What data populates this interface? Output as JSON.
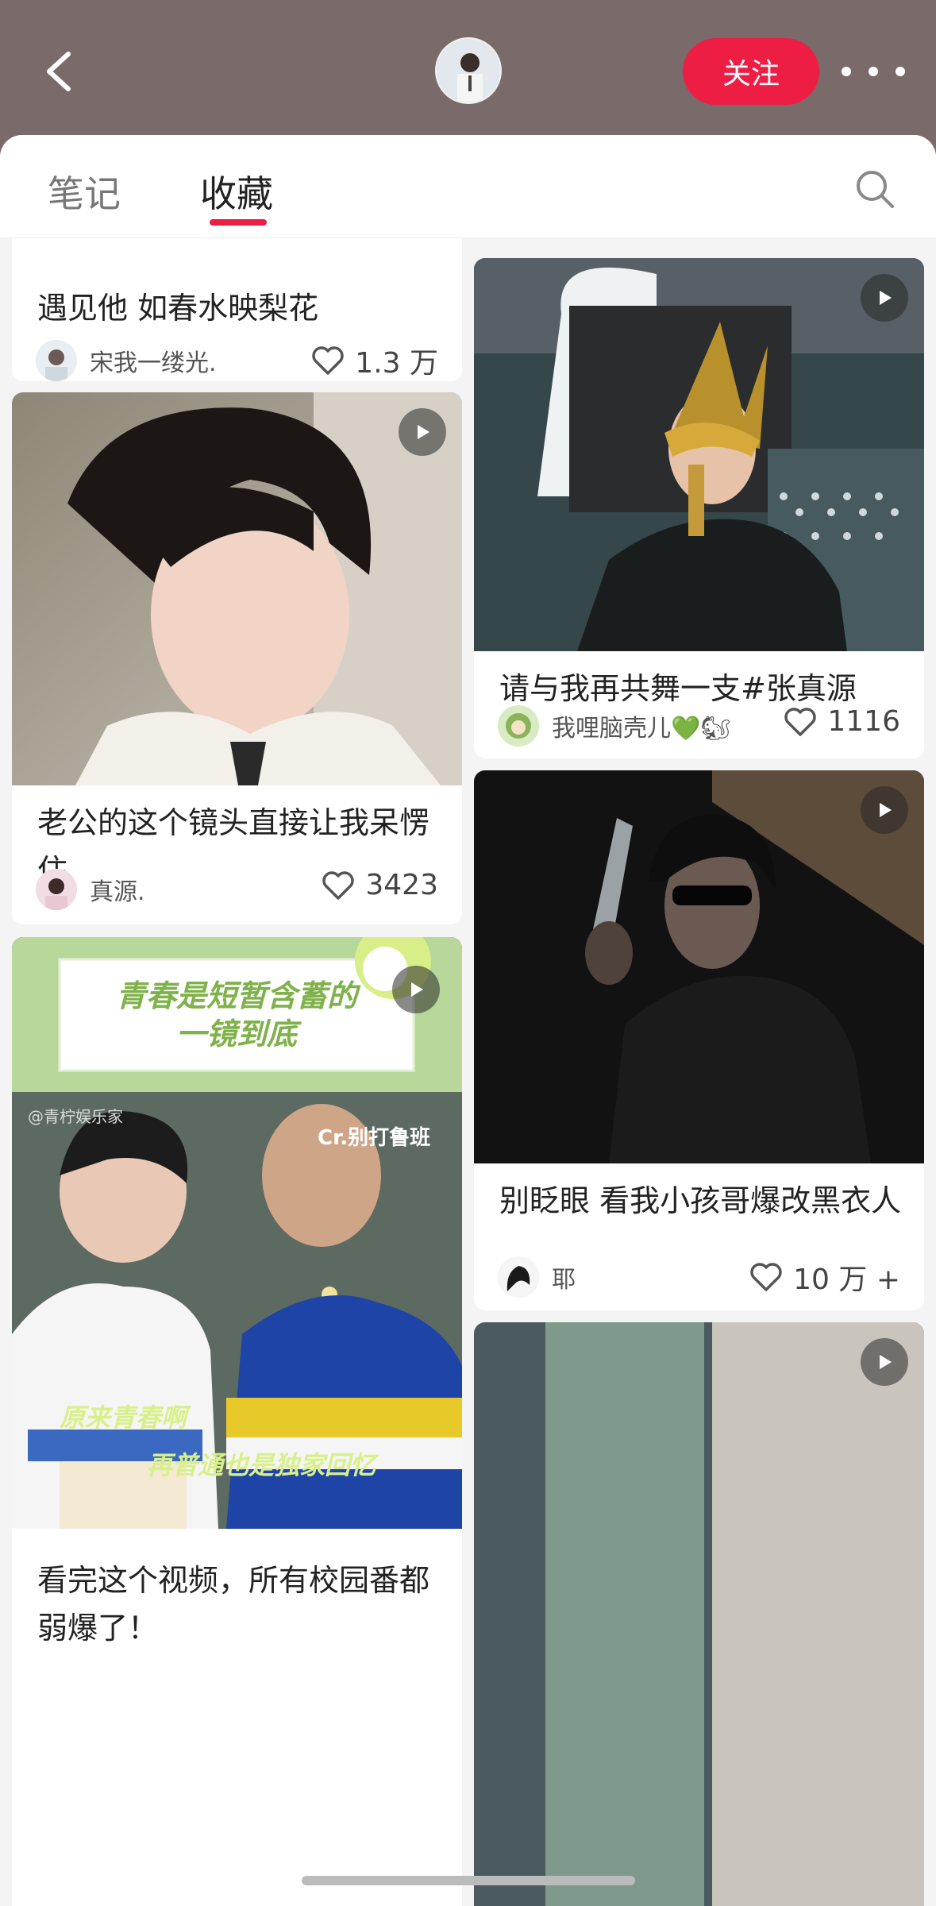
{
  "header": {
    "back_icon": "chevron-left-icon",
    "follow_label": "关注",
    "more_icon": "more-dots-icon",
    "accent_color": "#ee1d44"
  },
  "tabs": [
    {
      "label": "笔记",
      "active": false
    },
    {
      "label": "收藏",
      "active": true
    }
  ],
  "search_icon": "search-icon",
  "left_column": [
    {
      "title": "遇见他 如春水映梨花",
      "author": "宋我一缕光.",
      "likes": "1.3 万",
      "video": false
    },
    {
      "title": "老公的这个镜头直接让我呆愣住",
      "author": "真源.",
      "likes": "3423",
      "video": true
    },
    {
      "title": "看完这个视频，所有校园番都弱爆了！",
      "author": "",
      "likes": "",
      "video": true,
      "image_text": {
        "banner_line1": "青春是短暂含蓄的",
        "banner_line2": "一镜到底",
        "watermark": "@青柠娱乐家",
        "credit": "Cr.别打鲁班",
        "caption1": "原来青春啊",
        "caption2": "再普通也是独家回忆"
      }
    }
  ],
  "right_column": [
    {
      "title": "请与我再共舞一支#张真源",
      "author": "我哩脑壳儿💚🐿",
      "likes": "1116",
      "video": true
    },
    {
      "title": "别眨眼 看我小孩哥爆改黑衣人",
      "author": "耶",
      "likes": "10 万 +",
      "video": true
    }
  ]
}
